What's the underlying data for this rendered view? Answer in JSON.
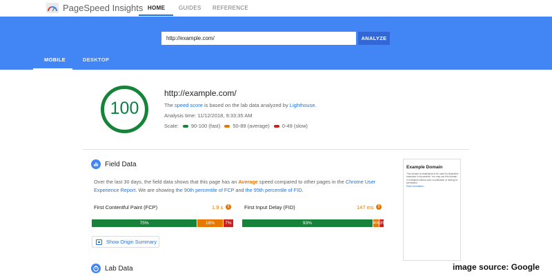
{
  "header": {
    "brand": "PageSpeed Insights",
    "tabs": [
      {
        "label": "HOME",
        "active": true
      },
      {
        "label": "GUIDES",
        "active": false
      },
      {
        "label": "REFERENCE",
        "active": false
      }
    ]
  },
  "search": {
    "value": "http://example.com/",
    "analyze_label": "ANALYZE"
  },
  "device_tabs": [
    {
      "label": "MOBILE",
      "active": true
    },
    {
      "label": "DESKTOP",
      "active": false
    }
  ],
  "score": {
    "value": "100",
    "fraction": 1.0,
    "url": "http://example.com/",
    "desc_pre": "The ",
    "desc_link1": "speed score",
    "desc_mid": " is based on the lab data analyzed by ",
    "desc_link2": "Lighthouse",
    "desc_post": ".",
    "analysis_time": "Analysis time: 11/12/2018, 9:33:35 AM",
    "scale_label": "Scale:",
    "scale_fast": "90-100 (fast)",
    "scale_average": "50-89 (average)",
    "scale_slow": "0-49 (slow)"
  },
  "field_data": {
    "title": "Field Data",
    "desc_1": "Over the last 30 days, the field data shows that this page has an ",
    "desc_avg": "Average",
    "desc_2": " speed compared to other pages in the ",
    "desc_link1": "Chrome User Experience Report",
    "desc_3": ". We are showing ",
    "desc_link2": "the 90th percentile of FCP",
    "desc_4": " and ",
    "desc_link3": "the 95th percentile of FID",
    "desc_5": ".",
    "metrics": [
      {
        "name": "First Contentful Paint (FCP)",
        "value": "1.9 s",
        "fast": 75,
        "average": 18,
        "slow": 7,
        "fast_label": "75%",
        "average_label": "18%",
        "slow_label": "7%"
      },
      {
        "name": "First Input Delay (FID)",
        "value": "147 ms",
        "fast": 93,
        "average": 4,
        "slow": 3,
        "fast_label": "93%",
        "average_label": "4%",
        "slow_label": "3%"
      }
    ],
    "origin_button": "Show Origin Summary"
  },
  "lab_data": {
    "title": "Lab Data"
  },
  "thumbnail": {
    "title": "Example Domain",
    "text": "This domain is established to be used for illustrative examples in documents. You may use this domain in examples without prior coordination or asking for permission.",
    "link": "More information..."
  },
  "credit": "image source: Google",
  "colors": {
    "brand_blue": "#4285f4",
    "fast": "#178239",
    "average": "#e67700",
    "slow": "#c7221f",
    "link": "#1a73e8"
  },
  "icons": [
    "pagespeed-logo-icon",
    "bar-chart-icon",
    "info-icon",
    "origin-summary-icon",
    "stopwatch-icon"
  ]
}
